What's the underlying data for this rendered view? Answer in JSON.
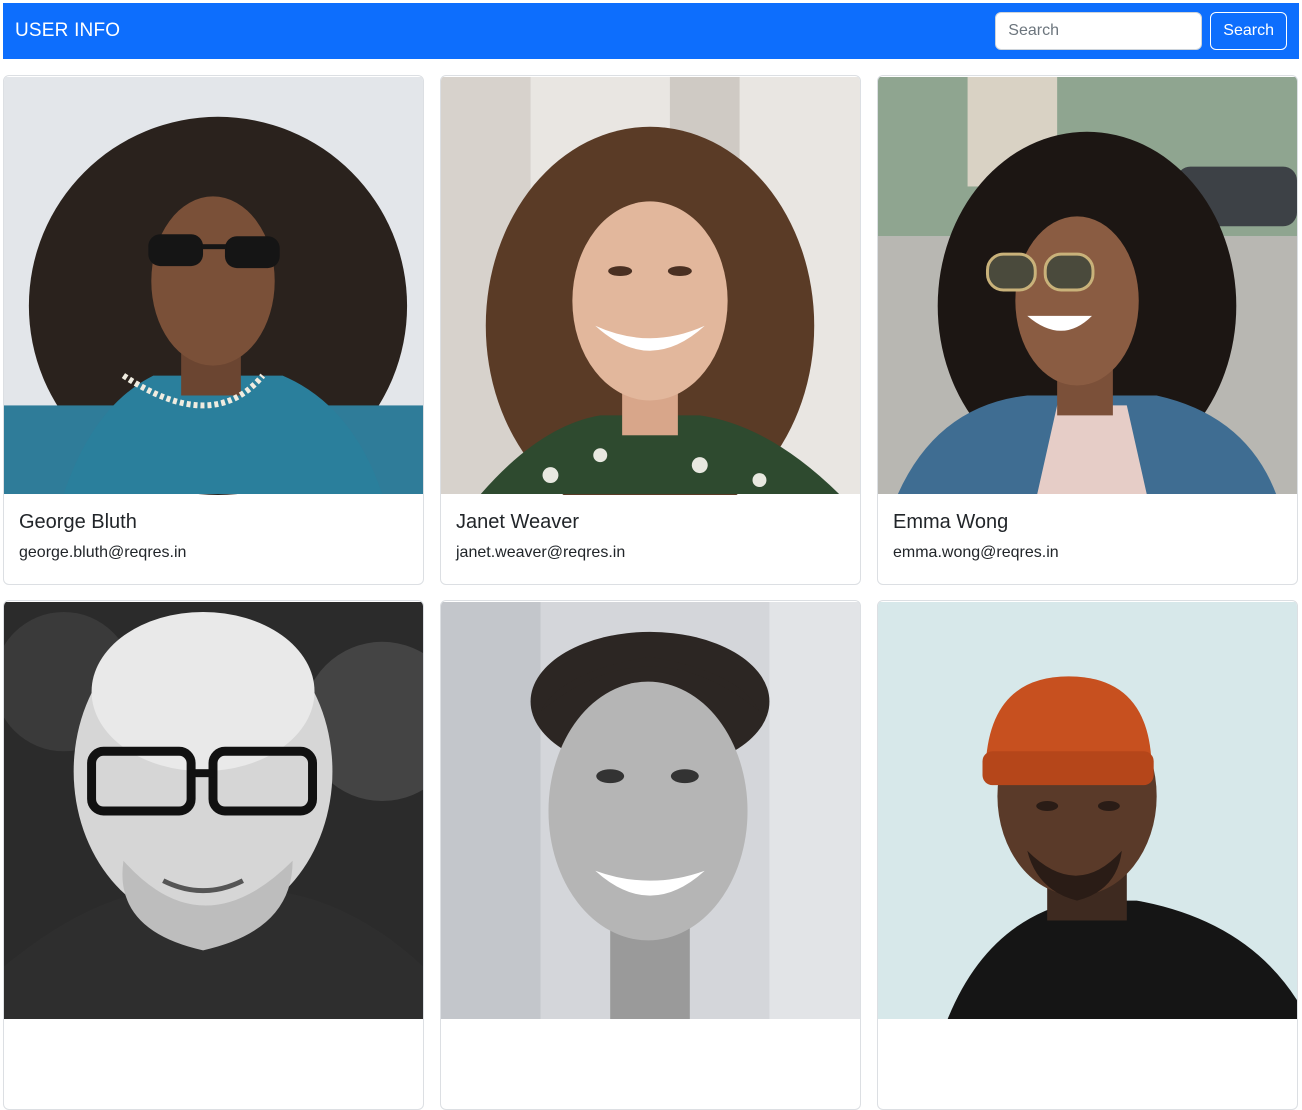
{
  "navbar": {
    "brand": "USER INFO",
    "search_placeholder": "Search",
    "search_button": "Search",
    "color": "#0d6efd"
  },
  "users": [
    {
      "name": "George Bluth",
      "email": "george.bluth@reqres.in"
    },
    {
      "name": "Janet Weaver",
      "email": "janet.weaver@reqres.in"
    },
    {
      "name": "Emma Wong",
      "email": "emma.wong@reqres.in"
    },
    {
      "name": "",
      "email": ""
    },
    {
      "name": "",
      "email": ""
    },
    {
      "name": "",
      "email": ""
    }
  ]
}
